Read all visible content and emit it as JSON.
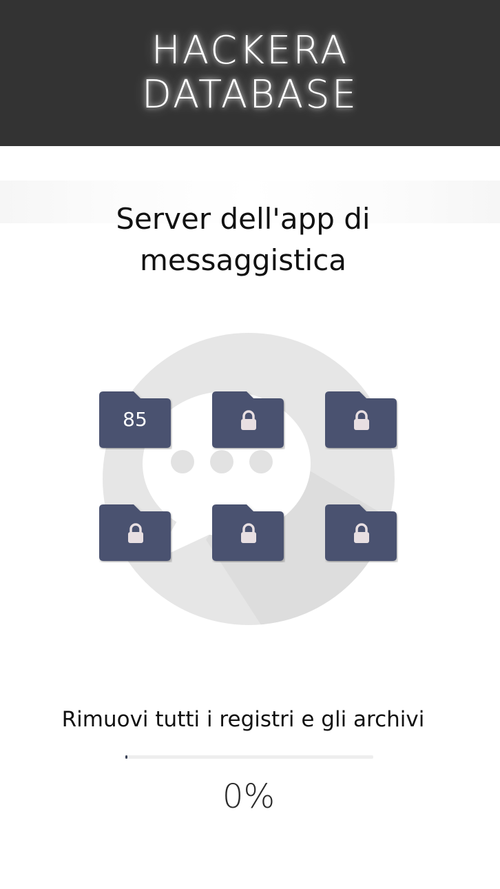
{
  "header": {
    "line1": "HACKERA",
    "line2": "DATABASE"
  },
  "server": {
    "title_line1": "Server dell'app di",
    "title_line2": "messaggistica"
  },
  "folders": [
    {
      "content": "85",
      "locked": false
    },
    {
      "content": "lock-icon",
      "locked": true
    },
    {
      "content": "lock-icon",
      "locked": true
    },
    {
      "content": "lock-icon",
      "locked": true
    },
    {
      "content": "lock-icon",
      "locked": true
    },
    {
      "content": "lock-icon",
      "locked": true
    }
  ],
  "task": {
    "label": "Rimuovi tutti i registri e gli archivi",
    "progress": 0,
    "percent_text": "0%"
  },
  "colors": {
    "header_bg": "#333333",
    "folder": "#4a5270",
    "bubble": "#e6e6e6",
    "lock": "#e8dfe2"
  }
}
